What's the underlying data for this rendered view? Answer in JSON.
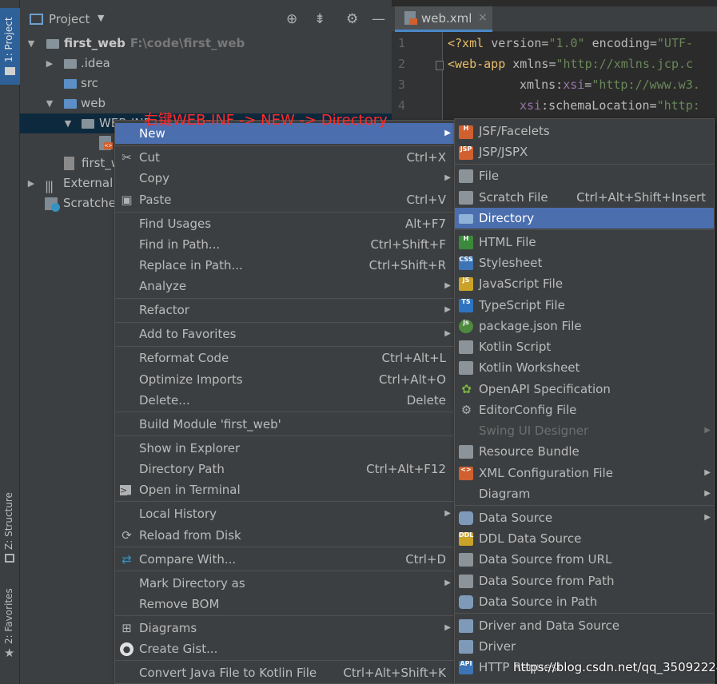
{
  "stripe": {
    "project_tab": "1: Project",
    "structure_tab": "Z: Structure",
    "favorites_tab": "2: Favorites"
  },
  "project_panel": {
    "title": "Project",
    "tree": [
      {
        "label": "first_web",
        "path": "F:\\code\\first_web"
      },
      {
        "label": ".idea"
      },
      {
        "label": "src"
      },
      {
        "label": "web"
      },
      {
        "label": "WEB-INF"
      },
      {
        "label": ""
      },
      {
        "label": "first_w"
      },
      {
        "label": "External I"
      },
      {
        "label": "Scratche"
      }
    ]
  },
  "editor": {
    "tab_title": "web.xml",
    "tab_close": "×",
    "line_numbers": [
      "1",
      "2",
      "3",
      "4"
    ],
    "code": {
      "l1_a": "<?xml ",
      "l1_b": "version",
      "l1_c": "=",
      "l1_d": "\"1.0\"",
      "l1_e": " encoding",
      "l1_f": "=",
      "l1_g": "\"UTF-",
      "l2_a": "<web-app ",
      "l2_b": "xmlns",
      "l2_c": "=",
      "l2_d": "\"http://xmlns.jcp.c",
      "l3_a": "xmlns:",
      "l3_b": "xsi",
      "l3_c": "=",
      "l3_d": "\"http://www.w3.",
      "l4_a": "xsi",
      "l4_b": ":schemaLocation",
      "l4_c": "=",
      "l4_d": "\"http:"
    }
  },
  "annotation": "右键WEB-INF -> NEW -> Directory",
  "context_menu": {
    "items": [
      {
        "label": "New",
        "shortcut": ""
      },
      {
        "label": "Cut",
        "shortcut": "Ctrl+X"
      },
      {
        "label": "Copy",
        "shortcut": ""
      },
      {
        "label": "Paste",
        "shortcut": "Ctrl+V"
      },
      {
        "label": "Find Usages",
        "shortcut": "Alt+F7"
      },
      {
        "label": "Find in Path...",
        "shortcut": "Ctrl+Shift+F"
      },
      {
        "label": "Replace in Path...",
        "shortcut": "Ctrl+Shift+R"
      },
      {
        "label": "Analyze",
        "shortcut": ""
      },
      {
        "label": "Refactor",
        "shortcut": ""
      },
      {
        "label": "Add to Favorites",
        "shortcut": ""
      },
      {
        "label": "Reformat Code",
        "shortcut": "Ctrl+Alt+L"
      },
      {
        "label": "Optimize Imports",
        "shortcut": "Ctrl+Alt+O"
      },
      {
        "label": "Delete...",
        "shortcut": "Delete"
      },
      {
        "label": "Build Module 'first_web'",
        "shortcut": ""
      },
      {
        "label": "Show in Explorer",
        "shortcut": ""
      },
      {
        "label": "Directory Path",
        "shortcut": "Ctrl+Alt+F12"
      },
      {
        "label": "Open in Terminal",
        "shortcut": ""
      },
      {
        "label": "Local History",
        "shortcut": ""
      },
      {
        "label": "Reload from Disk",
        "shortcut": ""
      },
      {
        "label": "Compare With...",
        "shortcut": "Ctrl+D"
      },
      {
        "label": "Mark Directory as",
        "shortcut": ""
      },
      {
        "label": "Remove BOM",
        "shortcut": ""
      },
      {
        "label": "Diagrams",
        "shortcut": ""
      },
      {
        "label": "Create Gist...",
        "shortcut": ""
      },
      {
        "label": "Convert Java File to Kotlin File",
        "shortcut": "Ctrl+Alt+Shift+K"
      }
    ]
  },
  "new_submenu": {
    "items": [
      {
        "label": "JSF/Facelets",
        "shortcut": ""
      },
      {
        "label": "JSP/JSPX",
        "shortcut": ""
      },
      {
        "label": "File",
        "shortcut": ""
      },
      {
        "label": "Scratch File",
        "shortcut": "Ctrl+Alt+Shift+Insert"
      },
      {
        "label": "Directory",
        "shortcut": ""
      },
      {
        "label": "HTML File",
        "shortcut": ""
      },
      {
        "label": "Stylesheet",
        "shortcut": ""
      },
      {
        "label": "JavaScript File",
        "shortcut": ""
      },
      {
        "label": "TypeScript File",
        "shortcut": ""
      },
      {
        "label": "package.json File",
        "shortcut": ""
      },
      {
        "label": "Kotlin Script",
        "shortcut": ""
      },
      {
        "label": "Kotlin Worksheet",
        "shortcut": ""
      },
      {
        "label": "OpenAPI Specification",
        "shortcut": ""
      },
      {
        "label": "EditorConfig File",
        "shortcut": ""
      },
      {
        "label": "Swing UI Designer",
        "shortcut": ""
      },
      {
        "label": "Resource Bundle",
        "shortcut": ""
      },
      {
        "label": "XML Configuration File",
        "shortcut": ""
      },
      {
        "label": "Diagram",
        "shortcut": ""
      },
      {
        "label": "Data Source",
        "shortcut": ""
      },
      {
        "label": "DDL Data Source",
        "shortcut": ""
      },
      {
        "label": "Data Source from URL",
        "shortcut": ""
      },
      {
        "label": "Data Source from Path",
        "shortcut": ""
      },
      {
        "label": "Data Source in Path",
        "shortcut": ""
      },
      {
        "label": "Driver and Data Source",
        "shortcut": ""
      },
      {
        "label": "Driver",
        "shortcut": ""
      },
      {
        "label": "HTTP Request",
        "shortcut": ""
      }
    ]
  },
  "watermark": "https://blog.csdn.net/qq_35092224",
  "colors": {
    "highlight": "#4b6eaf",
    "annotation": "#ff2a2a",
    "menu_bg": "#3c3f41"
  },
  "icons": [
    "project-icon",
    "target-icon",
    "collapse-icon",
    "gear-icon",
    "minimize-icon",
    "folder-icon",
    "xml-file-icon",
    "scissors-icon",
    "clipboard-icon",
    "refresh-icon",
    "compare-icon",
    "terminal-icon",
    "github-icon",
    "diagram-icon",
    "database-icon"
  ]
}
